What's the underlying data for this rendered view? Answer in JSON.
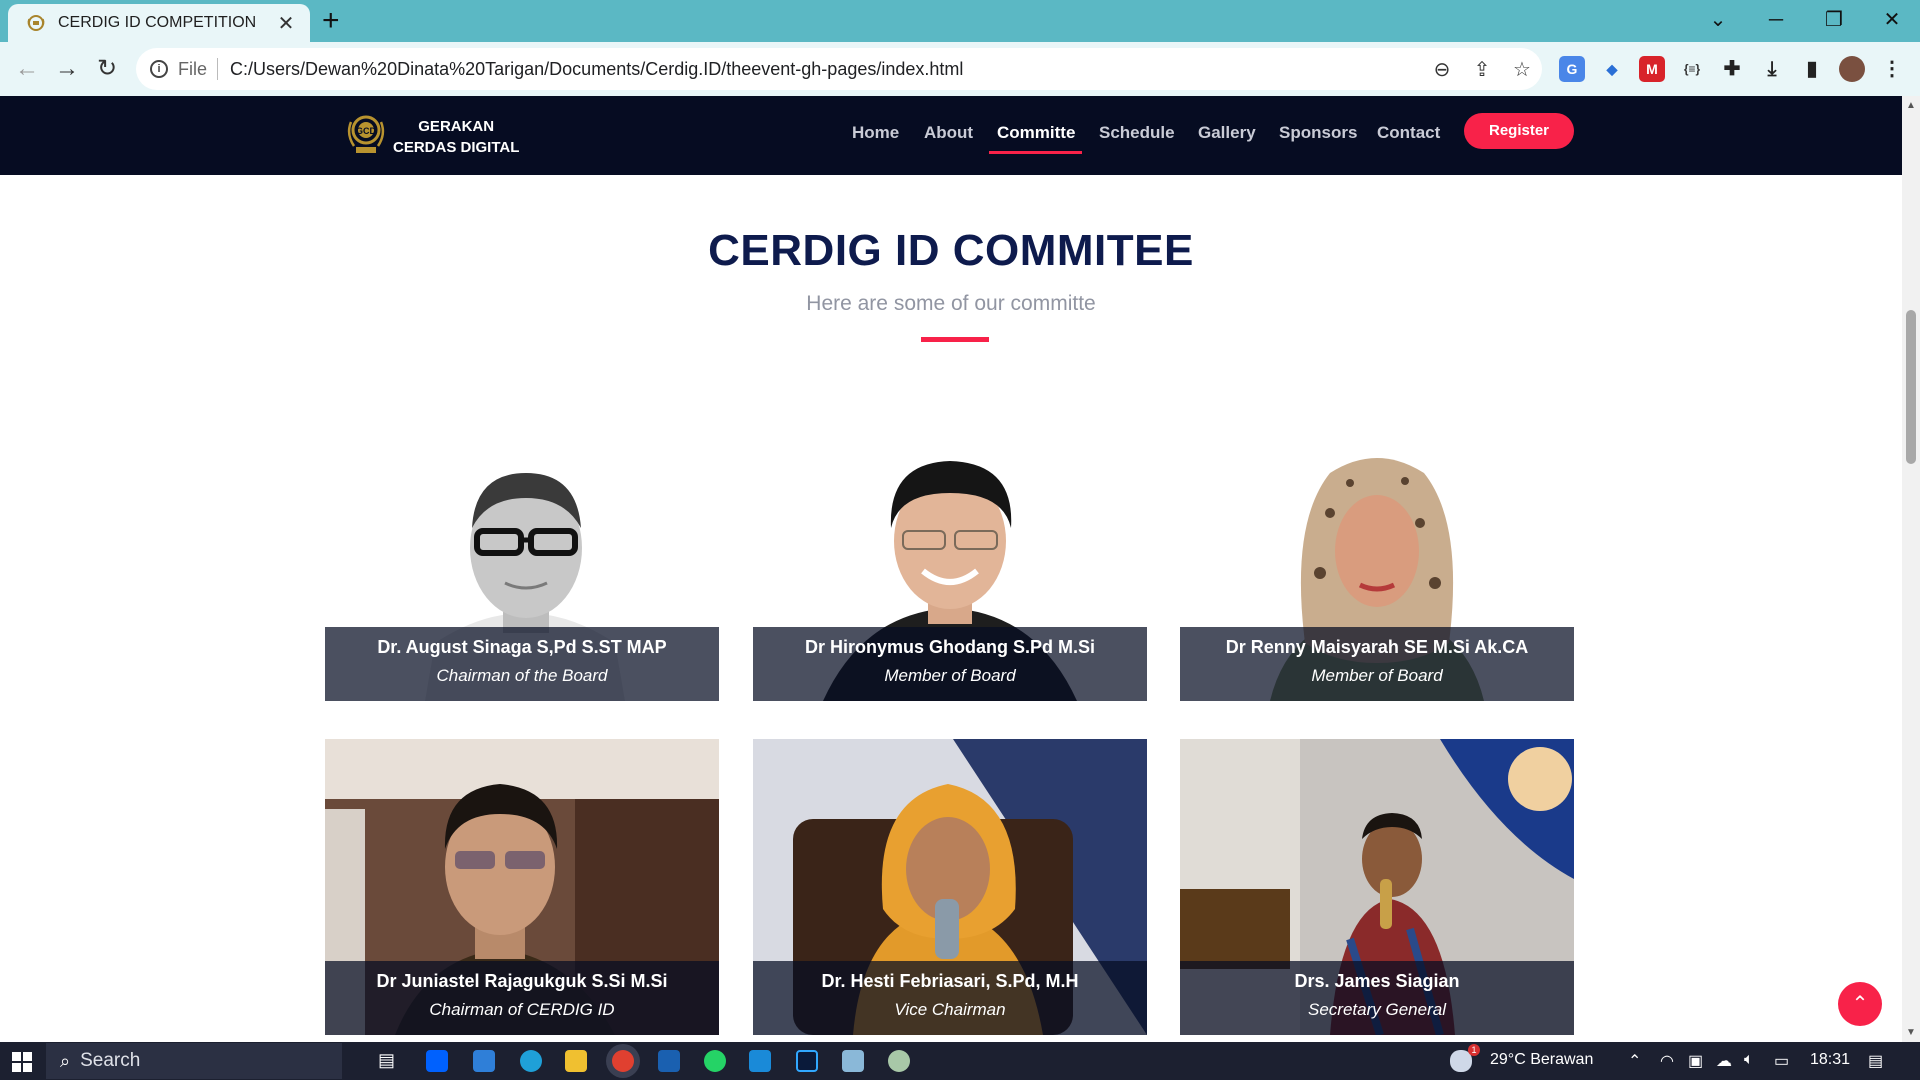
{
  "browser": {
    "tab_title": "CERDIG ID COMPETITION",
    "url_scheme": "File",
    "url": "C:/Users/Dewan%20Dinata%20Tarigan/Documents/Cerdig.ID/theevent-gh-pages/index.html"
  },
  "site": {
    "logo_line1": "GERAKAN",
    "logo_line2": "CERDAS DIGITAL",
    "nav": [
      "Home",
      "About",
      "Committe",
      "Schedule",
      "Gallery",
      "Sponsors",
      "Contact"
    ],
    "active_nav": "Committe",
    "register_label": "Register",
    "accent_color": "#f82249",
    "header_color": "#060c22",
    "title_color": "#0e1b4d"
  },
  "section": {
    "title": "CERDIG ID COMMITEE",
    "subtitle": "Here are some of our committe"
  },
  "committee": [
    {
      "name": "Dr. August Sinaga S,Pd S.ST MAP",
      "role": "Chairman of the Board"
    },
    {
      "name": "Dr Hironymus Ghodang S.Pd M.Si",
      "role": "Member of Board"
    },
    {
      "name": "Dr Renny Maisyarah SE M.Si Ak.CA",
      "role": "Member of Board"
    },
    {
      "name": "Dr Juniastel Rajagukguk S.Si M.Si",
      "role": "Chairman of CERDIG ID"
    },
    {
      "name": "Dr. Hesti Febriasari, S.Pd, M.H",
      "role": "Vice Chairman"
    },
    {
      "name": "Drs. James Siagian",
      "role": "Secretary General"
    }
  ],
  "taskbar": {
    "search_label": "Search",
    "weather": "29°C  Berawan",
    "time": "18:31",
    "weather_badge": "1"
  }
}
